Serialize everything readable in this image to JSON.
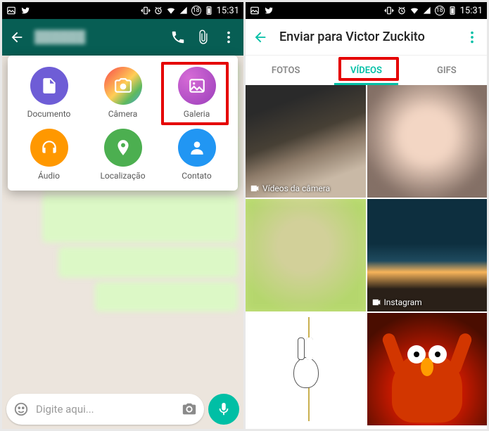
{
  "status": {
    "time": "15:31",
    "badge": "18"
  },
  "left": {
    "chat_name_blurred": "██████",
    "attach": {
      "document": "Documento",
      "camera": "Câmera",
      "gallery": "Galeria",
      "audio": "Áudio",
      "location": "Localização",
      "contact": "Contato"
    },
    "input_placeholder": "Digite aqui..."
  },
  "right": {
    "title": "Enviar para Victor Zuckito",
    "tabs": {
      "photos": "FOTOS",
      "videos": "VÍDEOS",
      "gifs": "GIFS"
    },
    "album1": "Vídeos da câmera",
    "album2": "Instagram"
  }
}
